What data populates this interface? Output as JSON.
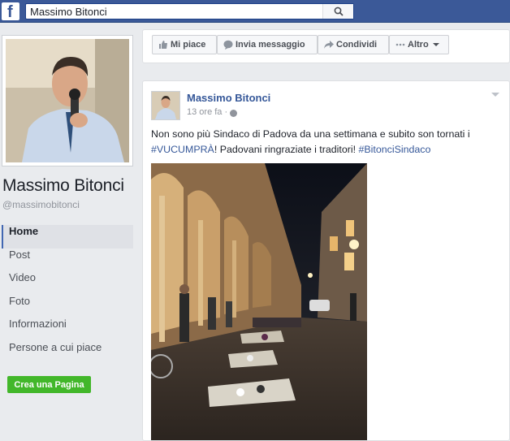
{
  "search": {
    "value": "Massimo Bitonci"
  },
  "profile": {
    "name": "Massimo Bitonci",
    "handle": "@massimobitonci"
  },
  "nav": {
    "items": [
      {
        "label": "Home",
        "active": true
      },
      {
        "label": "Post"
      },
      {
        "label": "Video"
      },
      {
        "label": "Foto"
      },
      {
        "label": "Informazioni"
      },
      {
        "label": "Persone a cui piace"
      }
    ]
  },
  "create_page_label": "Crea una Pagina",
  "actions": {
    "like": "Mi piace",
    "message": "Invia messaggio",
    "share": "Condividi",
    "more": "Altro"
  },
  "post": {
    "author": "Massimo Bitonci",
    "time": "13 ore fa · ",
    "text_1": "Non sono più Sindaco di Padova da una settimana e subito son tornati i ",
    "tag_1": "#VUCUMPRÀ",
    "text_2": "! Padovani ringraziate i traditori! ",
    "tag_2": "#BitonciSindaco"
  },
  "colors": {
    "brand": "#3b5998",
    "link": "#365899",
    "create_button": "#42b72a"
  },
  "icons": [
    "facebook-logo-icon",
    "search-icon",
    "thumbs-up-icon",
    "message-icon",
    "share-icon",
    "more-dots-icon",
    "globe-icon",
    "chevron-down-icon"
  ]
}
